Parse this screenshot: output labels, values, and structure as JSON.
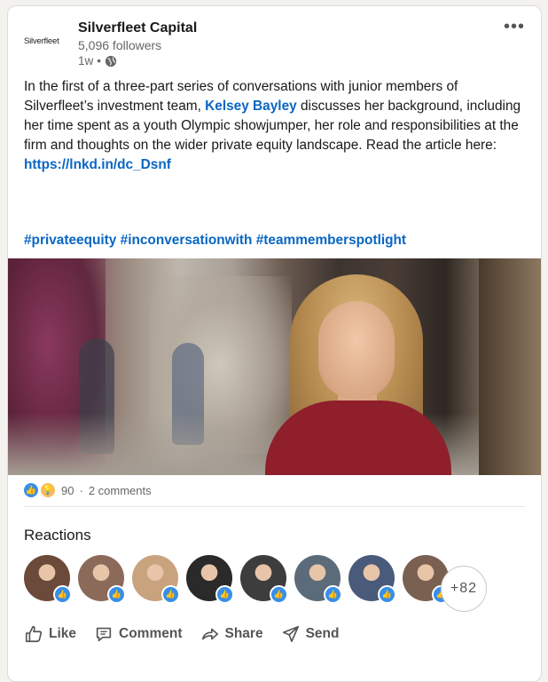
{
  "post": {
    "company_name": "Silverfleet Capital",
    "logo_text": "Silverfleet",
    "followers": "5,096 followers",
    "age": "1w",
    "age_separator": "•",
    "more_glyph": "•••",
    "body_part1": "In the first of a three-part series of conversations with junior members of Silverfleet’s investment team, ",
    "mention": "Kelsey Bayley",
    "body_part2": " discusses her background, including her time spent as a youth Olympic showjumper, her role and responsibilities at the firm and thoughts on the wider private equity landscape. Read the article here: ",
    "link": "https://lnkd.in/dc_Dsnf",
    "hashtags": "#privateequity #inconversationwith #teammemberspotlight"
  },
  "social": {
    "reaction_count": "90",
    "separator": "·",
    "comments": "2 comments"
  },
  "reactions": {
    "title": "Reactions",
    "avatar_colors": [
      "#6b4a3a",
      "#8b6a5a",
      "#c9a27e",
      "#2a2a2a",
      "#3d3d3d",
      "#5b6b7a",
      "#4a5a7a",
      "#7a6050"
    ],
    "more_count": "+82"
  },
  "actions": {
    "like": "Like",
    "comment": "Comment",
    "share": "Share",
    "send": "Send"
  },
  "colors": {
    "link": "#0a66c2",
    "like_badge": "#378fe9",
    "dress": "#8e1f2b"
  }
}
